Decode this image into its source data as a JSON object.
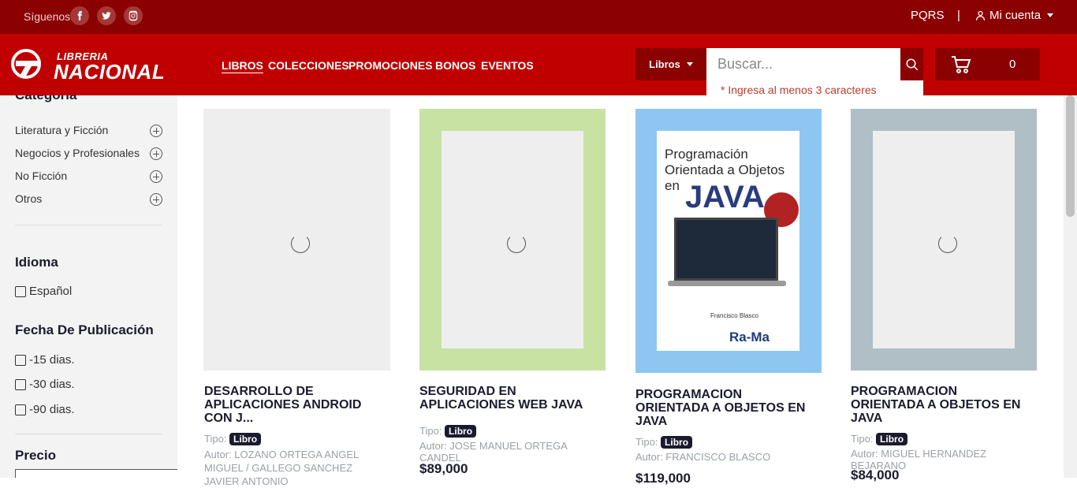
{
  "topbar": {
    "follow_label": "Síguenos",
    "pqrs": "PQRS",
    "separator": "|",
    "account": "Mi cuenta"
  },
  "logo": {
    "top": "LIBRERIA",
    "bottom": "NACIONAL"
  },
  "nav": {
    "items": [
      "LIBROS",
      "COLECCIONES",
      "PROMOCIONES",
      "BONOS",
      "EVENTOS"
    ]
  },
  "search": {
    "category": "Libros",
    "placeholder": "Buscar...",
    "hint": "* Ingresa al menos 3 caracteres"
  },
  "cart": {
    "count": "0"
  },
  "sidebar": {
    "category_heading": "Categoría",
    "categories": [
      "Literatura y Ficción",
      "Negocios y Profesionales",
      "No Ficción",
      "Otros"
    ],
    "language_heading": "Idioma",
    "languages": [
      "Español"
    ],
    "date_heading": "Fecha De Publicación",
    "dates": [
      "-15 dias.",
      "-30 dias.",
      "-90 dias."
    ],
    "price_heading": "Precio"
  },
  "products": [
    {
      "title": "DESARROLLO DE APLICACIONES ANDROID CON J...",
      "type_label": "Tipo:",
      "type": "Libro",
      "author": "Autor: LOZANO ORTEGA ANGEL MIGUEL / GALLEGO SANCHEZ JAVIER ANTONIO",
      "price": ""
    },
    {
      "title": "SEGURIDAD EN APLICACIONES WEB JAVA",
      "type_label": "Tipo:",
      "type": "Libro",
      "author": "Autor: JOSE MANUEL ORTEGA CANDEL",
      "price": "$89,000"
    },
    {
      "title": "PROGRAMACION ORIENTADA A OBJETOS EN JAVA",
      "type_label": "Tipo:",
      "type": "Libro",
      "author": "Autor: FRANCISCO BLASCO",
      "price": "$119,000"
    },
    {
      "title": "PROGRAMACION ORIENTADA A OBJETOS EN JAVA",
      "type_label": "Tipo:",
      "type": "Libro",
      "author": "Autor: MIGUEL HERNANDEZ BEJARANO",
      "price": "$84,000"
    }
  ],
  "book_cover": {
    "title": "Programación Orientada a Objetos en",
    "java": "JAVA",
    "author": "Francisco Blasco",
    "publisher": "Ra-Ma"
  },
  "colors": {
    "top_bar": "#8b0000",
    "main_bar": "#c00000",
    "text_dark": "#1b1b2f",
    "hint": "#c0392b"
  }
}
